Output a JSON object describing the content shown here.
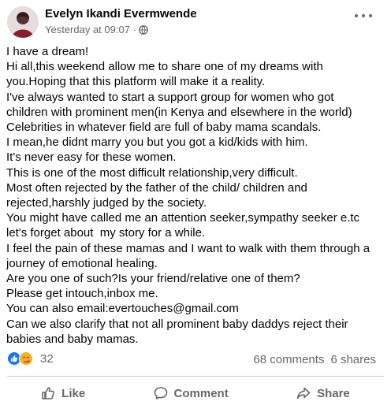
{
  "post": {
    "author": "Evelyn Ikandi Evermwende",
    "timestamp": "Yesterday at 09:07 ·",
    "privacy_icon": "globe-icon",
    "lines": [
      "I have a dream!",
      "Hi all,this weekend allow me to share one of my dreams with",
      "you.Hoping that this platform will make it a reality.",
      "I've always wanted to start a support group for women who got",
      "children with prominent men(in Kenya and elsewhere in the world)",
      "Celebrities in whatever field are full of baby mama scandals.",
      "I mean,he didnt marry you but you got a kid/kids with him.",
      "It's never easy for these women.",
      "This is one of the most difficult relationship,very difficult.",
      "Most often rejected by the father of the child/ children and",
      "rejected,harshly judged by the society.",
      "You might have called me an attention seeker,sympathy seeker e.tc",
      "let's forget about  my story for a while.",
      "I feel the pain of these mamas and I want to walk with them through a",
      "journey of emotional healing.",
      "Are you one of such?Is your friend/relative one of them?",
      "Please get intouch,inbox me.",
      "You can also email:evertouches@gmail.com",
      "Can we also clarify that not all prominent baby daddys reject their",
      "babies and baby mamas."
    ]
  },
  "engagement": {
    "reaction_count": "32",
    "comments": "68 comments",
    "shares": "6 shares"
  },
  "actions": {
    "like": "Like",
    "comment": "Comment",
    "share": "Share"
  },
  "colors": {
    "like_blue": "#1877f2",
    "care_yellow": "#f7b125",
    "secondary_text": "#65676b"
  }
}
